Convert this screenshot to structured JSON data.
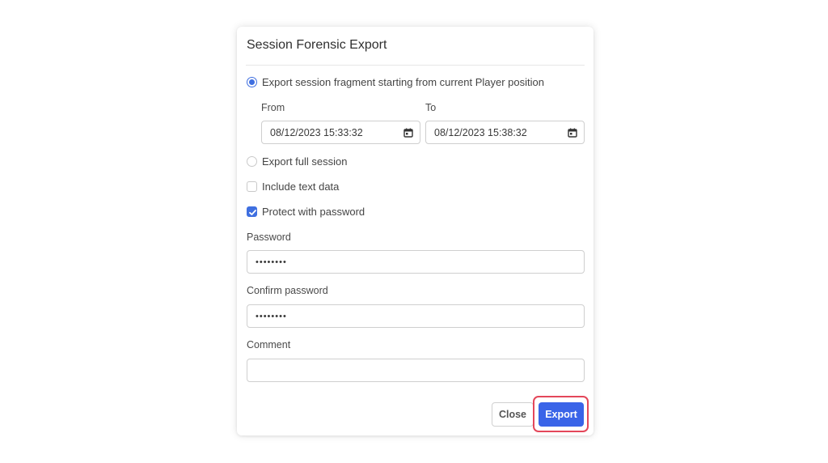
{
  "dialog": {
    "title": "Session Forensic Export",
    "fragment_option": {
      "label": "Export session fragment starting from current Player position",
      "checked": true
    },
    "from": {
      "label": "From",
      "value": "08/12/2023 15:33:32",
      "icon": "calendar-icon"
    },
    "to": {
      "label": "To",
      "value": "08/12/2023 15:38:32",
      "icon": "calendar-icon"
    },
    "full_option": {
      "label": "Export full session",
      "checked": false
    },
    "include_text": {
      "label": "Include text data",
      "checked": false
    },
    "protect": {
      "label": "Protect with password",
      "checked": true
    },
    "password": {
      "label": "Password",
      "value": "••••••••"
    },
    "confirm_password": {
      "label": "Confirm password",
      "value": "••••••••"
    },
    "comment": {
      "label": "Comment",
      "value": ""
    },
    "buttons": {
      "close": "Close",
      "export": "Export"
    }
  },
  "colors": {
    "accent": "#3a64e8",
    "highlight_ring": "#e4475a",
    "border": "#cfcfcf"
  }
}
